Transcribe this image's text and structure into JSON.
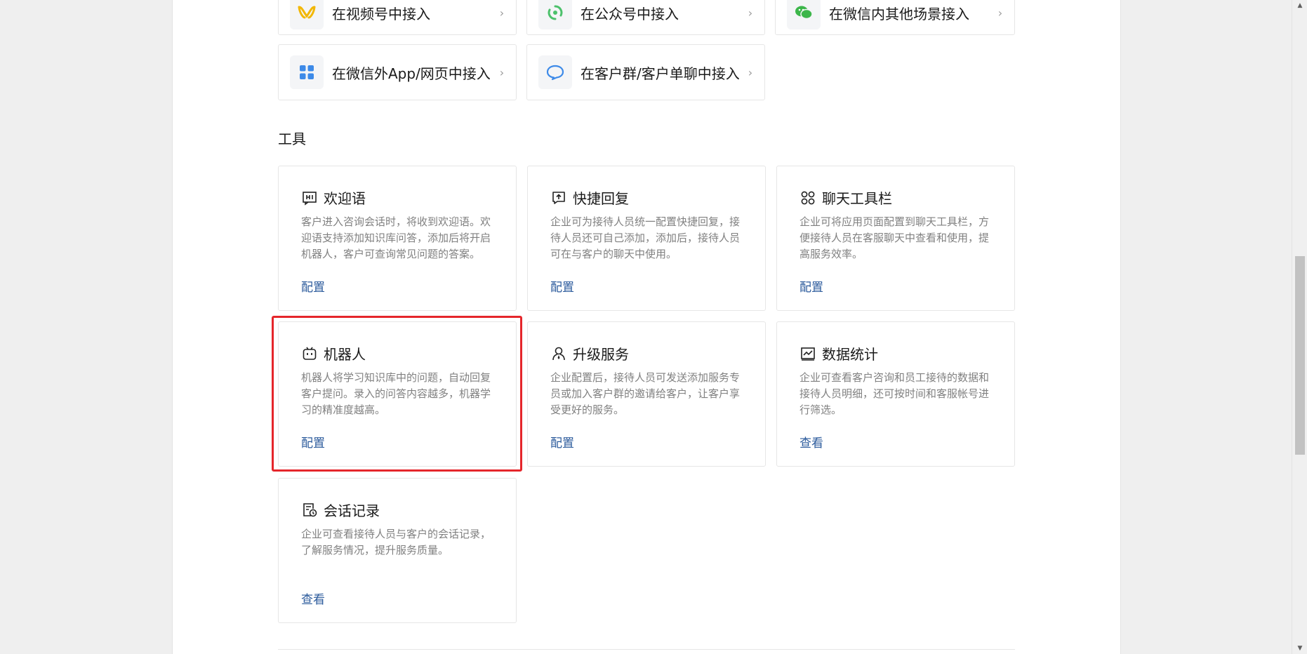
{
  "access": {
    "items": [
      {
        "label": "在视频号中接入",
        "icon": "channels-icon"
      },
      {
        "label": "在公众号中接入",
        "icon": "official-account-icon"
      },
      {
        "label": "在微信内其他场景接入",
        "icon": "wechat-icon"
      },
      {
        "label": "在微信外App/网页中接入",
        "icon": "app-grid-icon"
      },
      {
        "label": "在客户群/客户单聊中接入",
        "icon": "chat-bubble-icon"
      }
    ],
    "chevron": "›"
  },
  "tools": {
    "title": "工具",
    "cards": [
      {
        "title": "欢迎语",
        "desc": "客户进入咨询会话时，将收到欢迎语。欢迎语支持添加知识库问答，添加后将开启机器人，客户可查询常见问题的答案。",
        "action": "配置",
        "icon": "welcome-message-icon"
      },
      {
        "title": "快捷回复",
        "desc": "企业可为接待人员统一配置快捷回复，接待人员还可自己添加，添加后，接待人员可在与客户的聊天中使用。",
        "action": "配置",
        "icon": "quick-reply-icon"
      },
      {
        "title": "聊天工具栏",
        "desc": "企业可将应用页面配置到聊天工具栏，方便接待人员在客服聊天中查看和使用，提高服务效率。",
        "action": "配置",
        "icon": "toolbar-icon"
      },
      {
        "title": "机器人",
        "desc": "机器人将学习知识库中的问题，自动回复客户提问。录入的问答内容越多，机器学习的精准度越高。",
        "action": "配置",
        "icon": "robot-icon"
      },
      {
        "title": "升级服务",
        "desc": "企业配置后，接待人员可发送添加服务专员或加入客户群的邀请给客户，让客户享受更好的服务。",
        "action": "配置",
        "icon": "upgrade-service-icon"
      },
      {
        "title": "数据统计",
        "desc": "企业可查看客户咨询和员工接待的数据和接待人员明细，还可按时间和客服帐号进行筛选。",
        "action": "查看",
        "icon": "statistics-icon"
      },
      {
        "title": "会话记录",
        "desc": "企业可查看接待人员与客户的会话记录，了解服务情况，提升服务质量。",
        "action": "查看",
        "icon": "session-record-icon"
      }
    ]
  },
  "colors": {
    "link": "#2c5b9c",
    "highlight": "#e5262b",
    "channels": "#f2b705",
    "official_account": "#4cc16b",
    "wechat": "#3cb64a",
    "app": "#3d8ae8",
    "chat": "#3d8ae8"
  },
  "scrollbar": {
    "up": "▲",
    "down": "▼"
  }
}
